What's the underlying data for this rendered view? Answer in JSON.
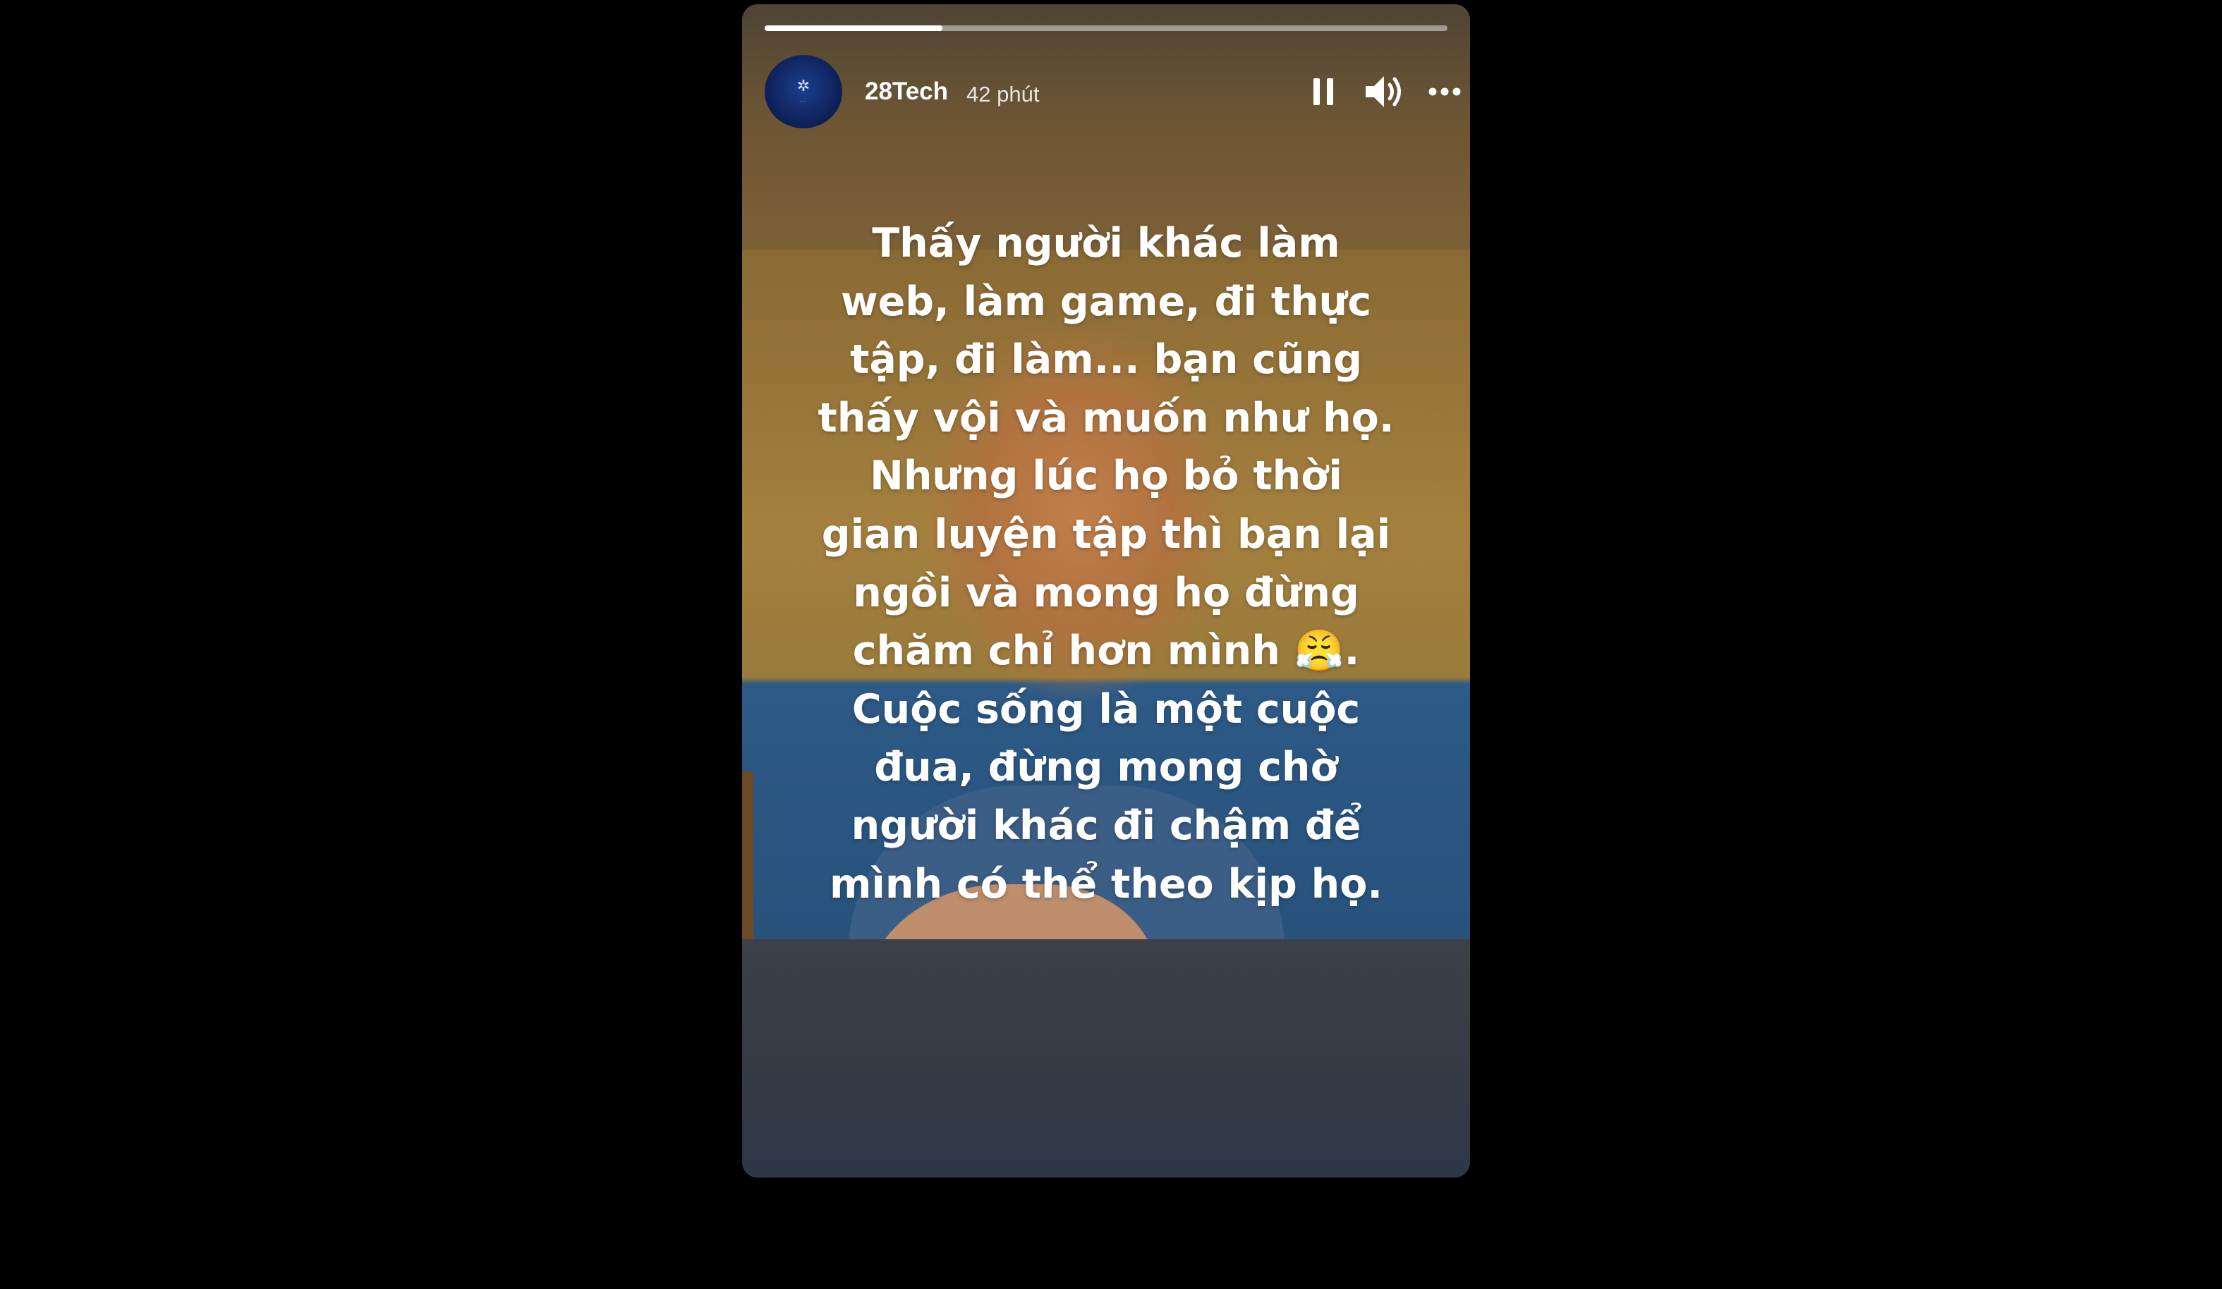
{
  "story": {
    "progress": 0.26,
    "author": {
      "name": "28Tech",
      "time": "42 phút",
      "avatar_icon": "28tech-logo"
    },
    "controls": {
      "pause_icon": "pause-icon",
      "sound_icon": "speaker-icon",
      "more_icon": "more-horizontal-icon"
    },
    "caption": "Thấy người khác làm\nweb, làm game, đi thực\ntập, đi làm... bạn cũng\nthấy vội và muốn như họ.\nNhưng lúc họ bỏ thời\ngian luyện tập thì bạn lại\nngồi và mong họ đừng\nchăm chỉ hơn mình 😤.\nCuộc sống là một cuộc\nđua, đừng mong chờ\nngười khác đi chậm để\nmình có thể theo kịp họ."
  },
  "colors": {
    "page_background": "#000000",
    "progress_track": "rgba(255,255,255,0.45)",
    "progress_fill": "#ffffff",
    "text": "#ffffff",
    "avatar": "#0c1f55"
  }
}
